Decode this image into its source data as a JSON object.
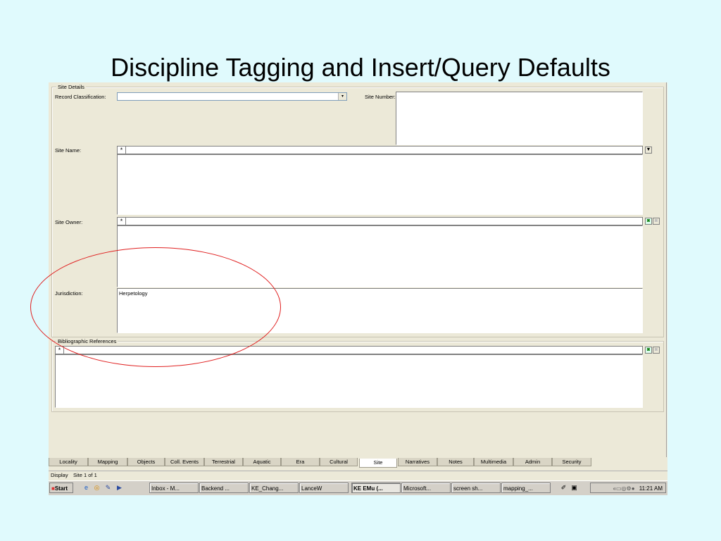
{
  "slide": {
    "title": "Discipline Tagging and Insert/Query Defaults"
  },
  "site_details": {
    "legend": "Site Details",
    "record_classification_label": "Record Classification:",
    "record_classification_value": "",
    "site_number_label": "Site Number:",
    "site_name_label": "Site Name:",
    "site_owner_label": "Site Owner:",
    "jurisdiction_label": "Jurisdiction:",
    "jurisdiction_value": "Herpetology"
  },
  "bibliographic": {
    "legend": "Bibliographic References"
  },
  "icons": {
    "star": "*",
    "dropdown": "▾"
  },
  "tabs": [
    "Locality",
    "Mapping",
    "Objects",
    "Coll. Events",
    "Terrestrial",
    "Aquatic",
    "Era",
    "Cultural",
    "Site",
    "Narratives",
    "Notes",
    "Multimedia",
    "Admin",
    "Security"
  ],
  "active_tab": "Site",
  "status": {
    "mode": "Display",
    "record": "Site 1 of 1"
  },
  "taskbar": {
    "start": "Start",
    "tasks": [
      "Inbox - M...",
      "Backend ...",
      "KE_Chang...",
      "LanceW",
      "KE EMu (...",
      "Microsoft...",
      "screen sh...",
      "mapping_..."
    ],
    "active_task": "KE EMu (...",
    "time": "11:21 AM"
  }
}
